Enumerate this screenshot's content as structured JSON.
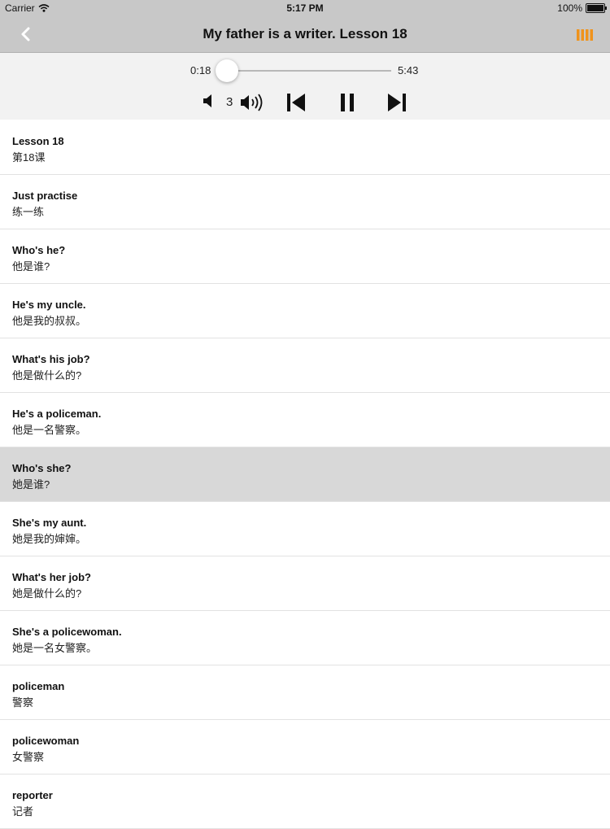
{
  "status_bar": {
    "carrier": "Carrier",
    "time": "5:17 PM",
    "battery": "100%",
    "wifi_icon": "wifi-icon",
    "battery_icon": "battery-icon"
  },
  "nav": {
    "title": "My father is a writer. Lesson 18",
    "back_icon": "chevron-left-icon",
    "menu_icon": "list-icon",
    "accent_color": "#f0931c"
  },
  "player": {
    "current_time": "0:18",
    "total_time": "5:43",
    "progress": 0.052,
    "volume_level": "3",
    "progress_color": "#2a8ee8"
  },
  "lesson_items": [
    {
      "en": "Lesson 18",
      "zh": "第18课",
      "selected": false
    },
    {
      "en": "Just practise",
      "zh": "练一练",
      "selected": false
    },
    {
      "en": "Who's he?",
      "zh": "他是谁?",
      "selected": false
    },
    {
      "en": "He's my uncle.",
      "zh": "他是我的叔叔。",
      "selected": false
    },
    {
      "en": "What's his job?",
      "zh": "他是做什么的?",
      "selected": false
    },
    {
      "en": "He's a policeman.",
      "zh": "他是一名警察。",
      "selected": false
    },
    {
      "en": "Who's she?",
      "zh": "她是谁?",
      "selected": true
    },
    {
      "en": "She's my aunt.",
      "zh": "她是我的婶婶。",
      "selected": false
    },
    {
      "en": "What's her job?",
      "zh": "她是做什么的?",
      "selected": false
    },
    {
      "en": "She's a policewoman.",
      "zh": "她是一名女警察。",
      "selected": false
    },
    {
      "en": "policeman",
      "zh": "警察",
      "selected": false
    },
    {
      "en": "policewoman",
      "zh": "女警察",
      "selected": false
    },
    {
      "en": "reporter",
      "zh": "记者",
      "selected": false
    }
  ]
}
